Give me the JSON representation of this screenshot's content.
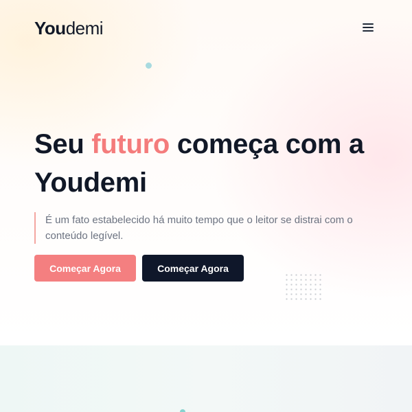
{
  "header": {
    "logo_bold": "You",
    "logo_light": "demi",
    "menu_icon": "hamburger-menu-icon"
  },
  "hero": {
    "headline_part1": "Seu ",
    "headline_accent": "futuro",
    "headline_part2": " começa com a Youdemi",
    "lead": "É um fato estabelecido há muito tempo que o leitor se distrai com o conteúdo legível.",
    "primary_button_label": "Começar Agora",
    "secondary_button_label": "Começar Agora"
  },
  "colors": {
    "accent": "#f47f80",
    "dark": "#0f172a",
    "text_muted": "#6b7280",
    "decor_dot": "#a8dadf",
    "section2_bg": "#eef7f5"
  }
}
